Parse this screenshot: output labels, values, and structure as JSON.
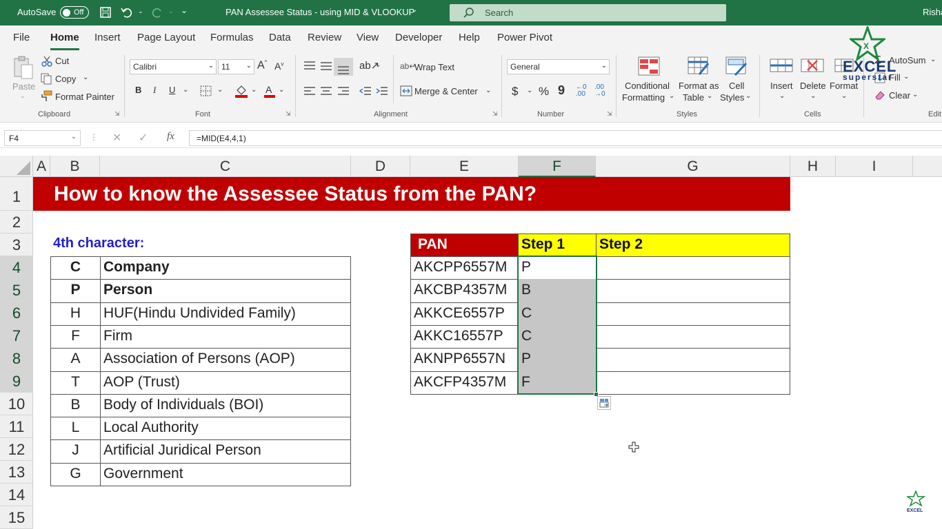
{
  "titlebar": {
    "autosave": "AutoSave",
    "toggle": "Off",
    "doc_title": "PAN Assessee Status - using MID & VLOOKUP",
    "search": "Search",
    "user": "Risha"
  },
  "menu": [
    "File",
    "Home",
    "Insert",
    "Page Layout",
    "Formulas",
    "Data",
    "Review",
    "View",
    "Developer",
    "Help",
    "Power Pivot"
  ],
  "ribbon": {
    "clipboard": {
      "paste": "Paste",
      "cut": "Cut",
      "copy": "Copy",
      "format_painter": "Format Painter",
      "group": "Clipboard"
    },
    "font": {
      "name": "Calibri",
      "size": "11",
      "bold": "B",
      "italic": "I",
      "underline": "U",
      "group": "Font"
    },
    "alignment": {
      "wrap": "Wrap Text",
      "merge": "Merge & Center",
      "group": "Alignment"
    },
    "number": {
      "format": "General",
      "currency": "$",
      "percent": "%",
      "comma": "9",
      "group": "Number"
    },
    "styles": {
      "conditional1": "Conditional",
      "conditional2": "Formatting",
      "format_as1": "Format as",
      "format_as2": "Table",
      "cell_styles1": "Cell",
      "cell_styles2": "Styles",
      "group": "Styles"
    },
    "cells": {
      "insert": "Insert",
      "delete": "Delete",
      "format": "Format",
      "group": "Cells"
    },
    "editing": {
      "autosum": "AutoSum",
      "fill": "Fill",
      "clear": "Clear",
      "group": "Edit"
    },
    "logo": {
      "line1": "EXCEL",
      "line2": "superstar"
    }
  },
  "formula_bar": {
    "cell_ref": "F4",
    "fx": "fx",
    "formula": "=MID(E4,4,1)"
  },
  "columns": [
    "A",
    "B",
    "C",
    "D",
    "E",
    "F",
    "G",
    "H",
    "I"
  ],
  "rows": [
    "1",
    "2",
    "3",
    "4",
    "5",
    "6",
    "7",
    "8",
    "9",
    "10",
    "11",
    "12",
    "13",
    "14",
    "15"
  ],
  "sheet": {
    "title": "How to know the Assessee Status from the PAN?",
    "char_label": "4th character:",
    "status_table": [
      {
        "code": "C",
        "desc": "Company",
        "bold": true
      },
      {
        "code": "P",
        "desc": "Person",
        "bold": true
      },
      {
        "code": "H",
        "desc": "HUF(Hindu Undivided Family)"
      },
      {
        "code": "F",
        "desc": "Firm"
      },
      {
        "code": "A",
        "desc": "Association of Persons (AOP)"
      },
      {
        "code": "T",
        "desc": "AOP (Trust)"
      },
      {
        "code": "B",
        "desc": "Body of Individuals (BOI)"
      },
      {
        "code": "L",
        "desc": "Local Authority"
      },
      {
        "code": "J",
        "desc": "Artificial Juridical Person"
      },
      {
        "code": "G",
        "desc": "Government"
      }
    ],
    "pan_headers": [
      "PAN",
      "Step 1",
      "Step 2"
    ],
    "pan_rows": [
      {
        "pan": "AKCPP6557M",
        "step1": "P",
        "step2": ""
      },
      {
        "pan": "AKCBP4357M",
        "step1": "B",
        "step2": ""
      },
      {
        "pan": "AKKCE6557P",
        "step1": "C",
        "step2": ""
      },
      {
        "pan": "AKKC16557P",
        "step1": "C",
        "step2": ""
      },
      {
        "pan": "AKNPP6557N",
        "step1": "P",
        "step2": ""
      },
      {
        "pan": "AKCFP4357M",
        "step1": "F",
        "step2": ""
      }
    ]
  },
  "colors": {
    "excel_green": "#217346",
    "banner_red": "#c00000",
    "header_yellow": "#ffff00",
    "header_red": "#c00000"
  }
}
